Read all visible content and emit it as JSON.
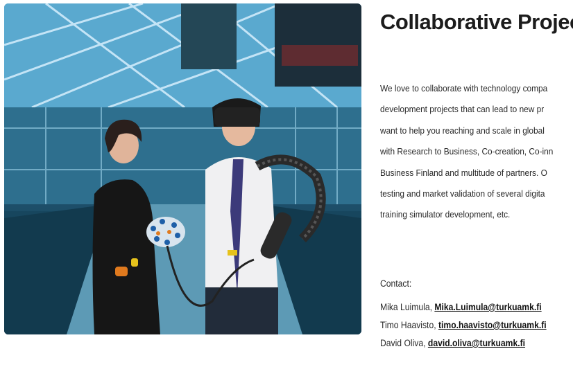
{
  "photo": {
    "alt_icon": "vr-collaboration-photo"
  },
  "title": "Collaborative Projects",
  "paragraph_lines": [
    "We love to collaborate with technology compa",
    "development projects that can lead to new pr",
    "want to help you reaching and scale in global",
    "with Research to Business, Co-creation, Co-inn",
    "Business Finland and multitude of partners. O",
    "testing and market validation of several digita",
    "training simulator development, etc."
  ],
  "contact_label": "Contact:",
  "contacts": [
    {
      "name": "Mika Luimula,",
      "email": "Mika.Luimula@turkuamk.fi"
    },
    {
      "name": "Timo Haavisto,",
      "email": "timo.haavisto@turkuamk.fi"
    },
    {
      "name": "David Oliva,",
      "email": "david.oliva@turkuamk.fi"
    }
  ]
}
